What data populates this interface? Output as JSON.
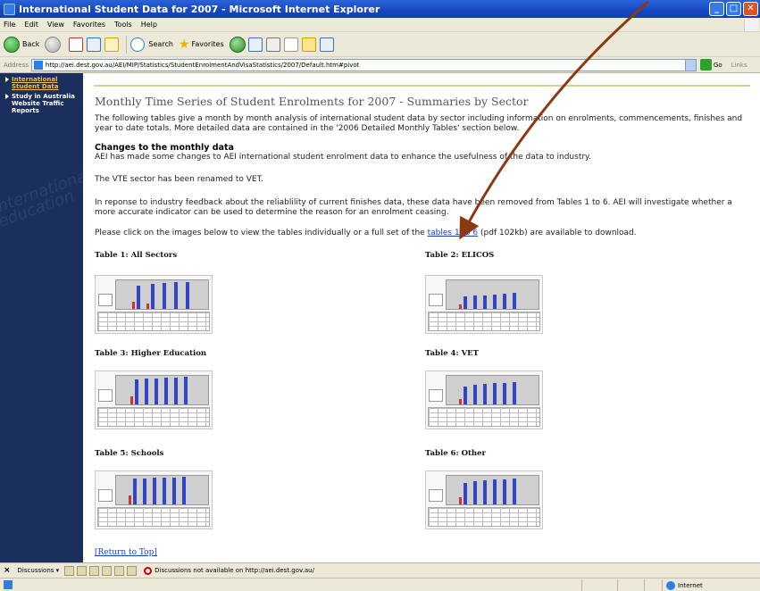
{
  "window": {
    "title": "International Student Data for 2007 - Microsoft Internet Explorer",
    "min": "_",
    "max": "□",
    "close": "✕"
  },
  "menu": [
    "File",
    "Edit",
    "View",
    "Favorites",
    "Tools",
    "Help"
  ],
  "toolbar": {
    "back": "Back",
    "search": "Search",
    "favorites": "Favorites"
  },
  "address": {
    "label": "Address",
    "url": "http://aei.dest.gov.au/AEI/MIP/Statistics/StudentEnrolmentAndVisaStatistics/2007/Default.htm#pivot",
    "go": "Go",
    "links": "Links"
  },
  "sidebar": {
    "items": [
      {
        "label": "International Student Data"
      },
      {
        "label": "Study in Australia Website Traffic Reports"
      }
    ],
    "bg_text": "international education"
  },
  "main": {
    "title": "Monthly Time Series of Student Enrolments for 2007 - Summaries by Sector",
    "intro": "The following tables give a month by month analysis of international student data by sector including information on enrolments, commencements, finishes and year to date totals. More detailed data are contained in the '2006 Detailed Monthly Tables' section below.",
    "changes_heading": "Changes to the monthly data",
    "changes_text": "AEI has made some changes to AEI international student enrolment data to enhance the usefulness of the data to industry.",
    "vte_text": "The VTE sector has been renamed to VET.",
    "finishes_text": "In reponse to industry feedback about the reliablility of current finishes data, these data have been removed from Tables 1 to 6. AEI will investigate whether a more accurate indicator can be used to determine the reason for an enrolment ceasing.",
    "download_prefix": "Please click on the images below to view the tables individually or a full set of the ",
    "download_link": "tables 1 to 6",
    "download_suffix": " (pdf 102kb) are available to download.",
    "tables": [
      {
        "label": "Table 1: All Sectors"
      },
      {
        "label": "Table 2: ELICOS"
      },
      {
        "label": "Table 3: Higher Education"
      },
      {
        "label": "Table 4: VET"
      },
      {
        "label": "Table 5: Schools"
      },
      {
        "label": "Table 6: Other"
      }
    ],
    "return_top": "[Return to Top]"
  },
  "discussion": {
    "close": "×",
    "button": "Discussions ▾",
    "message": "Discussions not available on http://aei.dest.gov.au/"
  },
  "status": {
    "zone": "Internet"
  },
  "colors": {
    "sidebar_bg": "#1b2f5c",
    "arrow": "#8b3a10",
    "link": "#1a3fc6",
    "title_bar": "#1747c0"
  }
}
